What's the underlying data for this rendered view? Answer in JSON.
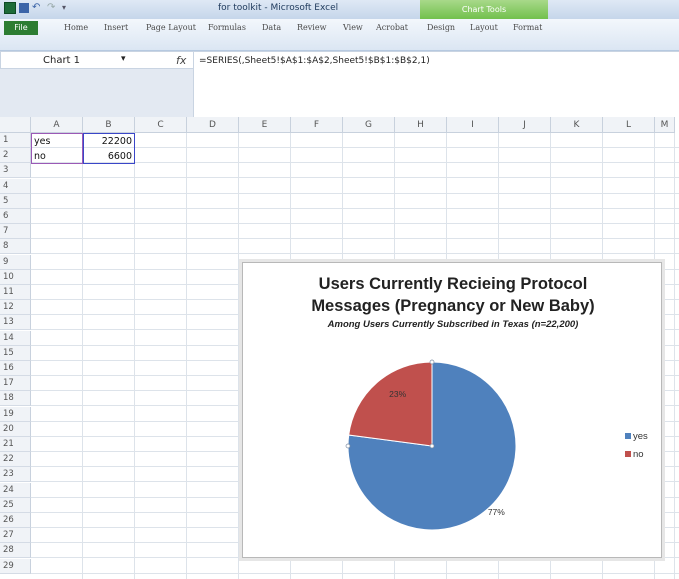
{
  "window": {
    "title": "for toolkit - Microsoft Excel",
    "context_tab_group": "Chart Tools"
  },
  "ribbon": {
    "file_tab": "File",
    "tabs": [
      "Home",
      "Insert",
      "Page Layout",
      "Formulas",
      "Data",
      "Review",
      "View",
      "Acrobat",
      "Design",
      "Layout",
      "Format"
    ]
  },
  "formula_bar": {
    "name_box": "Chart 1",
    "fx_label": "fx",
    "formula": "=SERIES(,Sheet5!$A$1:$A$2,Sheet5!$B$1:$B$2,1)"
  },
  "columns": [
    "A",
    "B",
    "C",
    "D",
    "E",
    "F",
    "G",
    "H",
    "I",
    "J",
    "K",
    "L",
    "M"
  ],
  "rows": [
    "1",
    "2",
    "3",
    "4",
    "5",
    "6",
    "7",
    "8",
    "9",
    "10",
    "11",
    "12",
    "13",
    "14",
    "15",
    "16",
    "17",
    "18",
    "19",
    "20",
    "21",
    "22",
    "23",
    "24",
    "25",
    "26",
    "27",
    "28",
    "29"
  ],
  "cells": {
    "A1": "yes",
    "B1": "22200",
    "A2": "no",
    "B2": "6600"
  },
  "chart": {
    "title_line1": "Users Currently Recieing Protocol",
    "title_line2": "Messages (Pregnancy or New Baby)",
    "subtitle": "Among Users Currently Subscribed in Texas (n=22,200)",
    "legend": [
      {
        "label": "yes",
        "color": "#4f81bd"
      },
      {
        "label": "no",
        "color": "#c0504d"
      }
    ]
  },
  "chart_data": {
    "type": "pie",
    "title": "Users Currently Recieing Protocol Messages (Pregnancy or New Baby)",
    "subtitle": "Among Users Currently Subscribed in Texas (n=22,200)",
    "categories": [
      "yes",
      "no"
    ],
    "values": [
      22200,
      6600
    ],
    "data_labels": [
      "77%",
      "23%"
    ],
    "colors": [
      "#4f81bd",
      "#c0504d"
    ],
    "legend_position": "right"
  }
}
